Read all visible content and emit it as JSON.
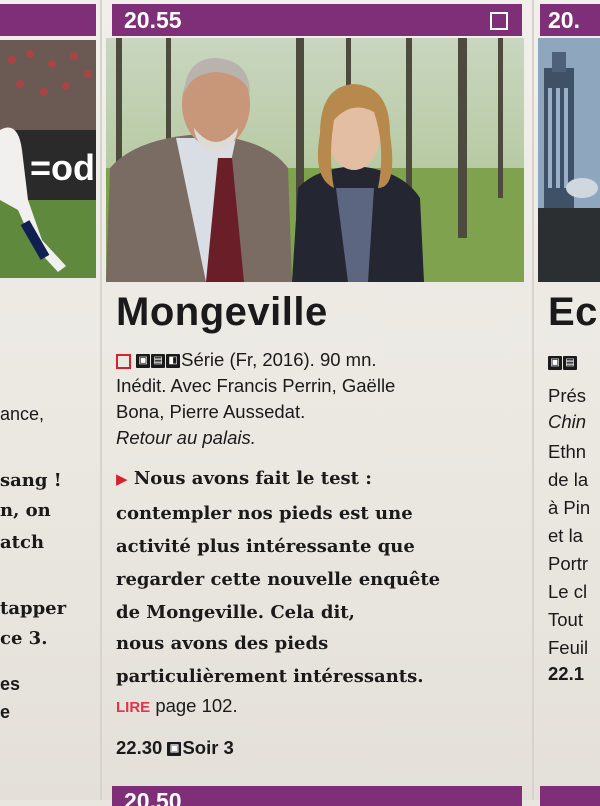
{
  "left_column": {
    "lines": [
      "ance,",
      "sang !",
      "n, on",
      "atch",
      "tapper",
      "ce 3.",
      "es",
      "e"
    ]
  },
  "center_listing": {
    "time": "20.55",
    "title": "Mongeville",
    "genre": "Série (Fr, 2016). 90 mn.",
    "cast_line1": "Inédit. Avec Francis Perrin, Gaëlle",
    "cast_line2": "Bona, Pierre Aussedat.",
    "episode": "Retour au palais.",
    "review_lines": [
      "Nous avons fait le test :",
      "contempler nos pieds est une",
      "activité plus intéressante que",
      "regarder cette nouvelle enquête",
      "de Mongeville. Cela dit,",
      "nous avons des pieds",
      "particulièrement intéressants."
    ],
    "read_label": "LIRE",
    "read_page": "page 102.",
    "next_time": "22.30",
    "next_show": "Soir 3",
    "next_bar_time": "20.50"
  },
  "right_column": {
    "time": "20.",
    "title": "Ec",
    "lines": [
      "Prés",
      "Chin",
      "Ethn",
      "de la",
      "à Pin",
      "et la",
      "Portr",
      "Le cl",
      "Tout",
      "Feuil",
      "22.1"
    ]
  },
  "colors": {
    "accent_bar": "#7f2f78",
    "red_arrow": "#d2242c",
    "lire_red": "#e0344a"
  },
  "icons": [
    "square-icon",
    "audio-description-icon",
    "subtitles-icon",
    "hd-icon",
    "play-triangle-icon"
  ]
}
